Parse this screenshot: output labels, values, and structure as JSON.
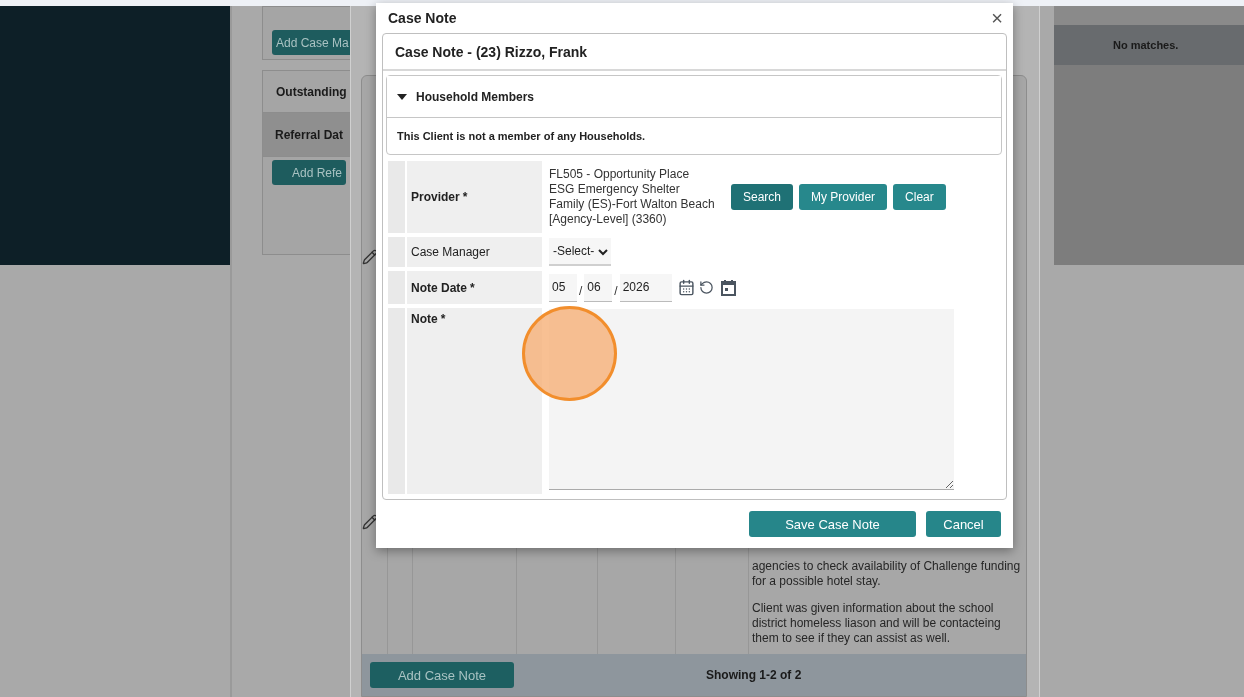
{
  "background": {
    "left_panel": {
      "add_case_manager_button": "Add Case Ma",
      "section_title": "Outstanding",
      "column_header": "Referral Dat",
      "add_referral_button": "Add Refe"
    },
    "right_panel": {
      "empty_message": "No matches."
    },
    "case_notes": {
      "note_paragraphs": [
        "agencies to check availability of Challenge funding for a possible hotel stay.",
        "Client was given information about the school district homeless liason and will be contacteing them to see if they can assist as well."
      ],
      "add_button": "Add Case Note",
      "pagination": "Showing 1-2 of 2"
    }
  },
  "dialog": {
    "title": "Case Note",
    "close": "×",
    "header": "Case Note - (23) Rizzo, Frank",
    "household": {
      "title": "Household Members",
      "expanded": true,
      "message": "This Client is not a member of any Households."
    },
    "fields": [
      {
        "kind": "provider",
        "label": "Provider",
        "required": true,
        "mark": "*",
        "value": "FL505 - Opportunity Place ESG Emergency Shelter Family (ES)-Fort Walton Beach [Agency-Level] (3360)",
        "buttons": [
          {
            "label": "Search",
            "selected": true
          },
          {
            "label": "My Provider",
            "selected": false
          },
          {
            "label": "Clear",
            "selected": false
          }
        ]
      },
      {
        "kind": "select",
        "label": "Case Manager",
        "required": false,
        "value": "-Select-"
      },
      {
        "kind": "date",
        "label": "Note Date",
        "required": true,
        "mark": "*",
        "month": "05",
        "day": "06",
        "year": "2026",
        "separator_1": "/",
        "separator_2": "/"
      },
      {
        "kind": "textarea",
        "label": "Note",
        "required": true,
        "mark": "*"
      }
    ],
    "buttons": [
      "Save Case Note",
      "Cancel"
    ]
  }
}
